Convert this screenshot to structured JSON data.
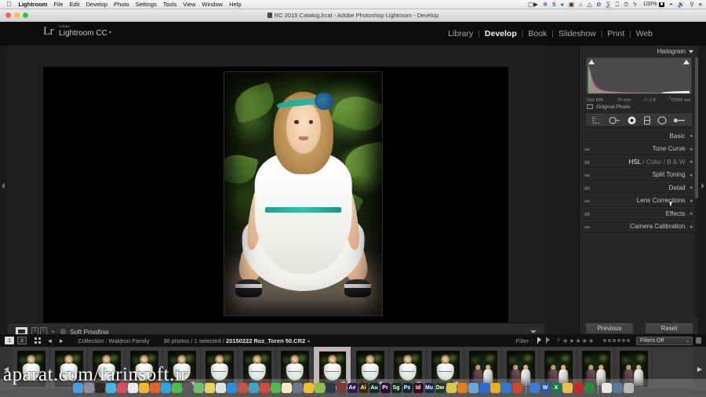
{
  "menubar": {
    "apple_icon": "apple-icon",
    "items": [
      "Lightroom",
      "File",
      "Edit",
      "Develop",
      "Photo",
      "Settings",
      "Tools",
      "View",
      "Window",
      "Help"
    ],
    "status": {
      "screen_recording_icon": "video-camera-icon",
      "dropbox_icon": "dropbox-icon",
      "dropbox_count": "9",
      "bird_icon": "bird-icon",
      "display_icon": "display-icon",
      "home_icon": "home-icon",
      "bell_icon": "bell-icon",
      "shield_icon": "shield-icon",
      "wave_icon": "waveform-icon",
      "airplay_icon": "airplay-icon",
      "timemachine_icon": "clock-icon",
      "bluetooth_icon": "bluetooth-icon",
      "battery_percent": "100%",
      "battery_icon": "battery-icon",
      "wifi_icon": "wifi-icon",
      "volume_icon": "volume-icon",
      "search_icon": "search-icon",
      "notification_icon": "list-icon"
    }
  },
  "titlebar": {
    "close_label": "close",
    "minimize_label": "minimize",
    "zoom_label": "zoom",
    "document_icon": "document-icon",
    "title": "RC 2015 Catalog.lrcat - Adobe Photoshop Lightroom - Develop"
  },
  "identity": {
    "mark": "Lr",
    "adobe": "Adobe",
    "product": "Lightroom CC",
    "caret": "▾"
  },
  "modules": {
    "items": [
      {
        "label": "Library",
        "active": false
      },
      {
        "label": "Develop",
        "active": true
      },
      {
        "label": "Book",
        "active": false
      },
      {
        "label": "Slideshow",
        "active": false
      },
      {
        "label": "Print",
        "active": false
      },
      {
        "label": "Web",
        "active": false
      }
    ],
    "separator": "|"
  },
  "right_panel": {
    "histogram_title": "Histogram",
    "collapse_icon": "triangle-down-icon",
    "clip_left_icon": "shadow-clipping-icon",
    "clip_right_icon": "highlight-clipping-icon",
    "exif": {
      "iso": "ISO 800",
      "focal": "70 mm",
      "aperture": "f / 2.8",
      "shutter_num": "1",
      "shutter_den": "2000",
      "shutter_unit": "sec"
    },
    "original_photo": {
      "icon": "screen-icon",
      "label": "Original Photo"
    },
    "tools": [
      {
        "name": "crop-overlay-icon",
        "selected": false
      },
      {
        "name": "spot-removal-icon",
        "selected": false
      },
      {
        "name": "red-eye-correction-icon",
        "selected": true
      },
      {
        "name": "graduated-filter-icon",
        "selected": false
      },
      {
        "name": "radial-filter-icon",
        "selected": false
      },
      {
        "name": "adjustment-brush-icon",
        "selected": false
      }
    ],
    "panels": [
      {
        "label": "Basic",
        "has_switch": false
      },
      {
        "label": "Tone Curve",
        "has_switch": true
      },
      {
        "label": "HSL / Color / B & W",
        "has_switch": true,
        "parts": [
          "HSL",
          "/",
          "Color",
          "/",
          "B & W"
        ],
        "current": "HSL"
      },
      {
        "label": "Split Toning",
        "has_switch": true
      },
      {
        "label": "Detail",
        "has_switch": true
      },
      {
        "label": "Lens Corrections",
        "has_switch": true,
        "hovered": true
      },
      {
        "label": "Effects",
        "has_switch": true
      },
      {
        "label": "Camera Calibration",
        "has_switch": true
      }
    ],
    "panel_chevron": "chevron-icon",
    "previous_button": "Previous",
    "reset_button": "Reset"
  },
  "toolbar": {
    "loupe_view_icon": "loupe-view-icon",
    "before_after_icon": "before-after-icon",
    "before_after_label_y": "Y",
    "reference_dot_icon": "dot-icon",
    "soft_proofing_checkbox": "soft-proofing-checkbox",
    "soft_proofing_label": "Soft Proofing",
    "toolbar_caret": "triangle-down-icon"
  },
  "filmstrip": {
    "screen1_label": "1",
    "screen2_label": "2",
    "grid_icon": "grid-view-icon",
    "back_arrow": "◄",
    "forward_arrow": "►",
    "collection_label": "Collection : Waldron Family",
    "photo_count": "36 photos / 1 selected /",
    "current_file": "20150222 Roz_Toren 50.CR2",
    "file_caret": "▾",
    "filter_label": "Filter :",
    "flag_pick_icon": "flag-pick-icon",
    "flag_reject_icon": "flag-reject-icon",
    "rating_prefix": "≥",
    "stars": [
      "★",
      "★",
      "★",
      "★",
      "★"
    ],
    "color_labels": [
      "red",
      "yellow",
      "green",
      "blue",
      "purple",
      "none"
    ],
    "filters_select": "Filters Off",
    "filters_select_caret": "⌄",
    "lock_icon": "lock-icon",
    "prev_nav_icon": "prev-photo-icon",
    "next_nav_icon": "next-photo-icon",
    "thumbnails": [
      {
        "kind": "girl",
        "selected": false,
        "badge": ""
      },
      {
        "kind": "girl",
        "selected": false,
        "badge": ""
      },
      {
        "kind": "girl",
        "selected": false,
        "badge": ""
      },
      {
        "kind": "girl",
        "selected": false,
        "badge": ""
      },
      {
        "kind": "girl",
        "selected": false,
        "badge": "▣"
      },
      {
        "kind": "girl",
        "selected": false,
        "badge": ""
      },
      {
        "kind": "girl",
        "selected": false,
        "badge": ""
      },
      {
        "kind": "girl",
        "selected": false,
        "badge": ""
      },
      {
        "kind": "girl",
        "selected": true,
        "badge": "▣"
      },
      {
        "kind": "girl",
        "selected": false,
        "badge": "▣"
      },
      {
        "kind": "girl",
        "selected": false,
        "badge": "▣"
      },
      {
        "kind": "girl",
        "selected": false,
        "badge": "▣"
      },
      {
        "kind": "duo",
        "selected": false,
        "badge": ""
      },
      {
        "kind": "duo",
        "selected": false,
        "badge": ""
      },
      {
        "kind": "duo",
        "selected": false,
        "badge": ""
      },
      {
        "kind": "duo",
        "selected": false,
        "badge": ""
      },
      {
        "kind": "duo",
        "selected": false,
        "badge": ""
      }
    ]
  },
  "watermark": {
    "text": "aparat.com/farinsoft.ir"
  },
  "dock": {
    "icons": [
      {
        "name": "finder-icon",
        "color": "#4a9fe0"
      },
      {
        "name": "siri-icon",
        "color": "#8c8c9c"
      },
      {
        "name": "mail-icon",
        "color": "#2a2a2a"
      },
      {
        "name": "safari-icon",
        "color": "#3fb6e8"
      },
      {
        "name": "photos-icon",
        "color": "#e04a5a"
      },
      {
        "name": "icloud-icon",
        "color": "#e8e8e8"
      },
      {
        "name": "chrome-icon",
        "color": "#f3b72c"
      },
      {
        "name": "firefox-icon",
        "color": "#e8622c"
      },
      {
        "name": "skype-icon",
        "color": "#2aa6e0"
      },
      {
        "name": "messages-icon",
        "color": "#4ac04a"
      },
      {
        "name": "preferences-icon",
        "color": "#5a5a5a"
      },
      {
        "name": "maps-icon",
        "color": "#6fbf6f"
      },
      {
        "name": "notes-icon",
        "color": "#ead35c"
      },
      {
        "name": "pages-icon",
        "color": "#e2e2e2"
      },
      {
        "name": "appstore-icon",
        "color": "#2a8fe0"
      },
      {
        "name": "itunes-icon",
        "color": "#c8523f"
      },
      {
        "name": "typekit-icon",
        "color": "#3aa6c8"
      },
      {
        "name": "creativecloud-icon",
        "color": "#d44a3a"
      },
      {
        "name": "evernote-icon",
        "color": "#4fb84f"
      },
      {
        "name": "stickies-icon",
        "color": "#f2eec0"
      },
      {
        "name": "screenflow-icon",
        "color": "#6a7a8a"
      },
      {
        "name": "camtasia-icon",
        "color": "#f0c020"
      },
      {
        "name": "scanner-icon",
        "color": "#8cc040"
      },
      {
        "name": "lightroom-icon",
        "color": "#2a3a4a"
      },
      {
        "name": "bridge-icon",
        "color": "#7a3a3a"
      },
      {
        "name": "after-effects-icon",
        "color": "#2a1a4a",
        "text": "Ae"
      },
      {
        "name": "illustrator-icon",
        "color": "#3a2a0a",
        "text": "Ai"
      },
      {
        "name": "audition-icon",
        "color": "#0a2a2a",
        "text": "Au"
      },
      {
        "name": "premiere-icon",
        "color": "#2a0a3a",
        "text": "Pr"
      },
      {
        "name": "speedgrade-icon",
        "color": "#0a2a1a",
        "text": "Sg"
      },
      {
        "name": "photoshop-icon",
        "color": "#0a2a3a",
        "text": "Ps"
      },
      {
        "name": "indesign-icon",
        "color": "#3a0a1a",
        "text": "Id"
      },
      {
        "name": "muse-icon",
        "color": "#1a2a4a",
        "text": "Mu"
      },
      {
        "name": "dreamweaver-icon",
        "color": "#1a3a1a",
        "text": "Dw"
      },
      {
        "name": "balsamiq-icon",
        "color": "#d8c84a"
      },
      {
        "name": "vlc-icon",
        "color": "#e87a1a"
      },
      {
        "name": "cyberduck-icon",
        "color": "#6aa8d8"
      },
      {
        "name": "teamviewer-icon",
        "color": "#2a6ad8"
      },
      {
        "name": "sketch-icon",
        "color": "#e8b020"
      },
      {
        "name": "dropbox-app-icon",
        "color": "#2a7ad8"
      },
      {
        "name": "handbrake-icon",
        "color": "#c84a2a"
      },
      {
        "name": "printer-icon",
        "color": "#3a7ad8"
      },
      {
        "name": "word-icon",
        "color": "#2a5aa8",
        "text": "W"
      },
      {
        "name": "excel-icon",
        "color": "#1a7a4a",
        "text": "X"
      },
      {
        "name": "keynote-icon",
        "color": "#e8c04a"
      },
      {
        "name": "acrobat-icon",
        "color": "#c82a2a"
      },
      {
        "name": "firefox2-icon",
        "color": "#2a8a3a"
      },
      {
        "name": "acrobat-reader-icon",
        "color": "#e8e8e8"
      },
      {
        "name": "downloads-stack-icon",
        "color": "#5a7a9a"
      },
      {
        "name": "trash-icon",
        "color": "#b8b8b8"
      }
    ]
  }
}
